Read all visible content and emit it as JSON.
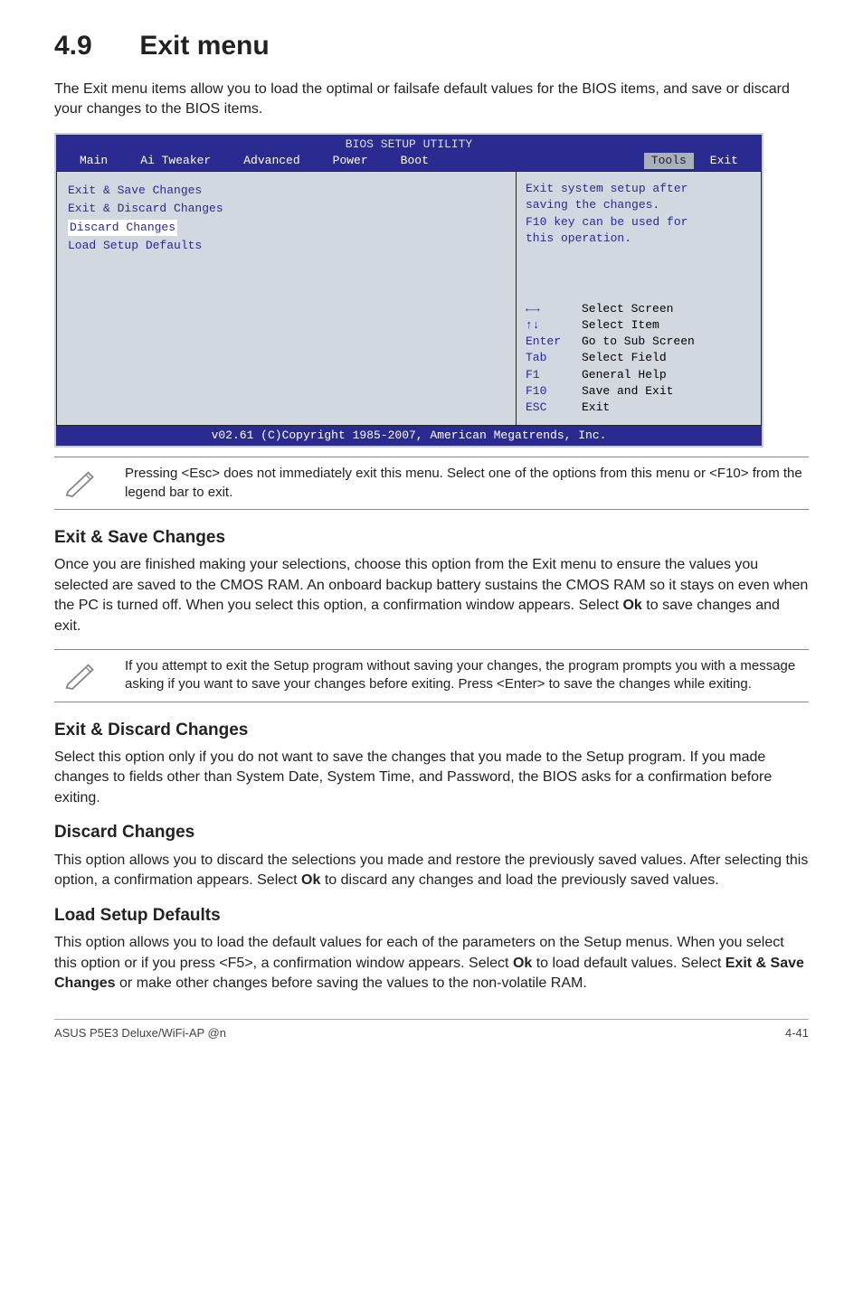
{
  "section": {
    "number": "4.9",
    "title": "Exit menu",
    "intro": "The Exit menu items allow you to load the optimal or failsafe default values for the BIOS items, and save or discard your changes to the BIOS items."
  },
  "bios": {
    "util_title": "BIOS SETUP UTILITY",
    "menu": [
      "Main",
      "Ai Tweaker",
      "Advanced",
      "Power",
      "Boot",
      "Tools",
      "Exit"
    ],
    "menu_selected": "Tools",
    "left_items": [
      "Exit & Save Changes",
      "Exit & Discard Changes",
      "Discard Changes",
      "",
      "Load Setup Defaults"
    ],
    "help": [
      "Exit system setup after",
      "saving the changes.",
      "",
      "F10 key can be used for",
      "this operation."
    ],
    "keys": [
      {
        "k": "←→",
        "d": "Select Screen",
        "cls": "arrow"
      },
      {
        "k": "↑↓",
        "d": "Select Item",
        "cls": "arrow2"
      },
      {
        "k": "Enter",
        "d": "Go to Sub Screen"
      },
      {
        "k": "Tab",
        "d": "Select Field"
      },
      {
        "k": "F1",
        "d": "General Help"
      },
      {
        "k": "F10",
        "d": "Save and Exit"
      },
      {
        "k": "ESC",
        "d": "Exit"
      }
    ],
    "footer": "v02.61 (C)Copyright 1985-2007, American Megatrends, Inc."
  },
  "note_esc": "Pressing <Esc> does not immediately exit this menu. Select one of the options from this menu or <F10> from the legend bar to exit.",
  "exit_save": {
    "heading": "Exit & Save Changes",
    "body_pre": "Once you are finished making your selections, choose this option from the Exit menu to ensure the values you selected are saved to the CMOS RAM. An onboard backup battery sustains the CMOS RAM so it stays on even when the PC is turned off. When you select this option, a confirmation window appears. Select ",
    "body_bold": "Ok",
    "body_post": " to save changes and exit."
  },
  "note_attempt": "If you attempt to exit the Setup program without saving your changes, the program prompts you with a message asking if you want to save your changes before exiting. Press <Enter> to save the changes while exiting.",
  "exit_discard": {
    "heading": "Exit & Discard Changes",
    "body": "Select this option only if you do not want to save the changes that you  made to the Setup program. If you made changes to fields other than System Date, System Time, and Password, the BIOS asks for a confirmation before exiting."
  },
  "discard": {
    "heading": "Discard Changes",
    "body_pre": "This option allows you to discard the selections you made and restore the previously saved values. After selecting this option, a confirmation appears. Select ",
    "body_bold": "Ok",
    "body_post": " to discard any changes and load the previously saved values."
  },
  "load": {
    "heading": "Load Setup Defaults",
    "body_pre": "This option allows you to load the default values for each of the parameters on the Setup menus. When you select this option or if you press <F5>, a confirmation window appears. Select ",
    "body_bold1": "Ok",
    "body_mid": " to load default values. Select ",
    "body_bold2": "Exit & Save Changes",
    "body_post": " or make other changes before saving the values to the non-volatile RAM."
  },
  "footer": {
    "left": "ASUS P5E3 Deluxe/WiFi-AP @n",
    "right": "4-41"
  }
}
